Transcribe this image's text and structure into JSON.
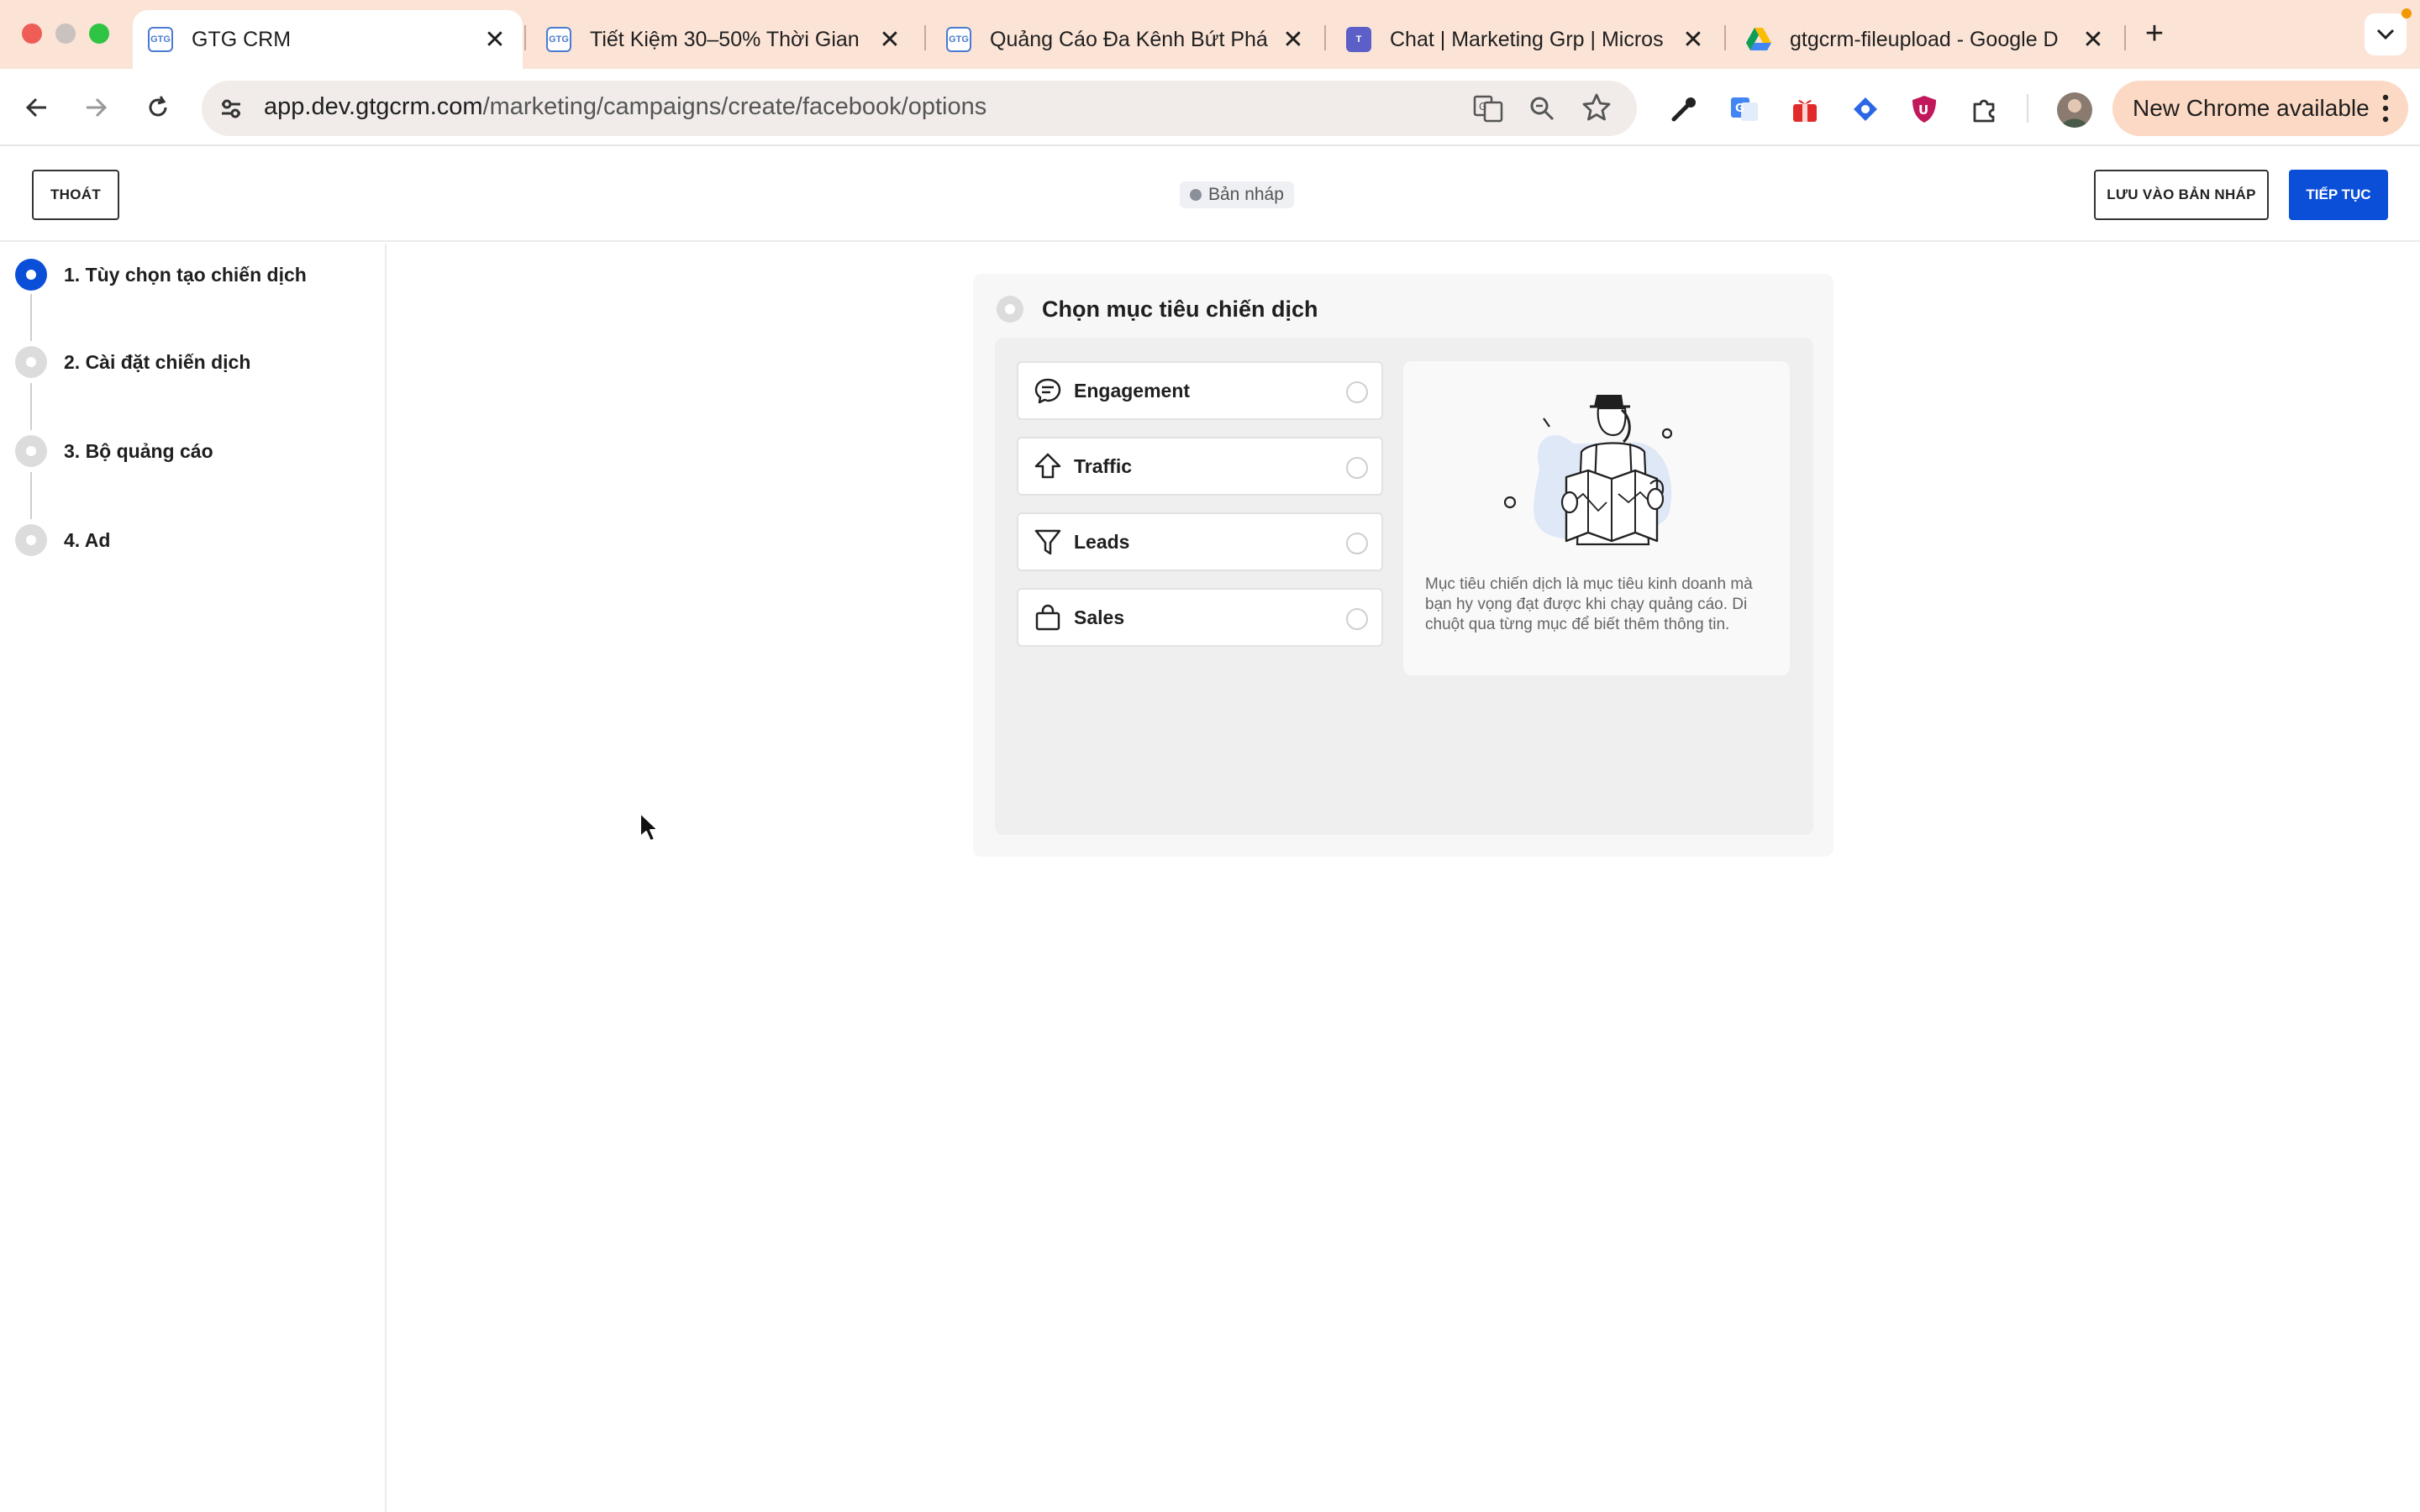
{
  "browser": {
    "tabs": [
      {
        "title": "GTG CRM",
        "active": true,
        "favicon": "gtg-logo-icon"
      },
      {
        "title": "Tiết Kiệm 30–50% Thời Gian",
        "active": false,
        "favicon": "gtg-logo-icon"
      },
      {
        "title": "Quảng Cáo Đa Kênh Bứt Phá",
        "active": false,
        "favicon": "gtg-logo-icon"
      },
      {
        "title": "Chat | Marketing Grp | Micros",
        "active": false,
        "favicon": "teams-icon"
      },
      {
        "title": "gtgcrm-fileupload - Google D",
        "active": false,
        "favicon": "google-drive-icon"
      }
    ],
    "url_host": "app.dev.gtgcrm.com",
    "url_path": "/marketing/campaigns/create/facebook/options",
    "new_chrome_label": "New Chrome available"
  },
  "header": {
    "exit_label": "THOÁT",
    "status_label": "Bản nháp",
    "save_draft_label": "LƯU VÀO BẢN NHÁP",
    "continue_label": "TIẾP TỤC"
  },
  "steps": [
    {
      "label": "1. Tùy chọn tạo chiến dịch",
      "active": true
    },
    {
      "label": "2. Cài đặt chiến dịch",
      "active": false
    },
    {
      "label": "3. Bộ quảng cáo",
      "active": false
    },
    {
      "label": "4. Ad",
      "active": false
    }
  ],
  "objective": {
    "title": "Chọn mục tiêu chiến dịch",
    "options": [
      {
        "label": "Engagement",
        "icon": "chat-bubble-icon"
      },
      {
        "label": "Traffic",
        "icon": "arrow-up-icon"
      },
      {
        "label": "Leads",
        "icon": "funnel-icon"
      },
      {
        "label": "Sales",
        "icon": "shopping-bag-icon"
      }
    ],
    "description": "Mục tiêu chiến dịch là mục tiêu kinh doanh mà bạn hy vọng đạt được khi chạy quảng cáo. Di chuột qua từng mục để biết thêm thông tin."
  },
  "colors": {
    "accent": "#0b4fd9",
    "tabstrip": "#fbe3d6"
  }
}
